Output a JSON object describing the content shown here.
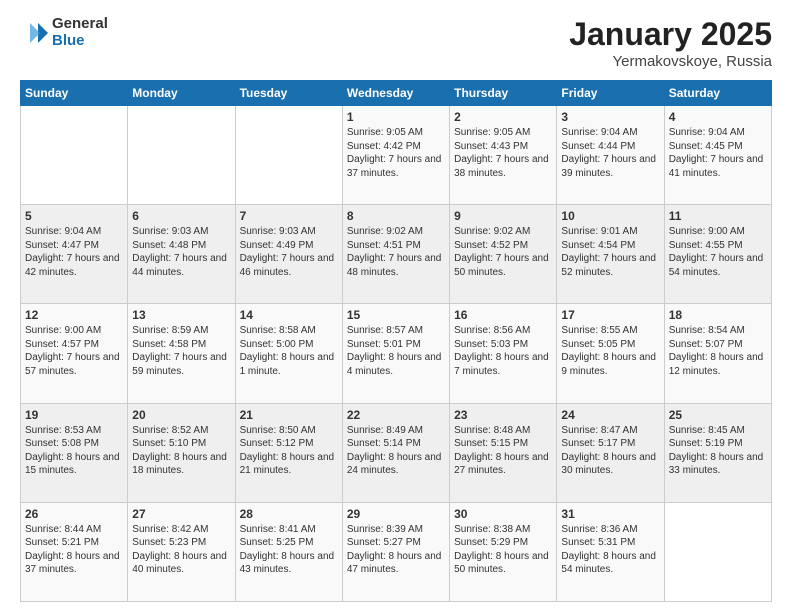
{
  "logo": {
    "general": "General",
    "blue": "Blue"
  },
  "title": "January 2025",
  "subtitle": "Yermakovskoye, Russia",
  "days_of_week": [
    "Sunday",
    "Monday",
    "Tuesday",
    "Wednesday",
    "Thursday",
    "Friday",
    "Saturday"
  ],
  "weeks": [
    [
      {
        "day": "",
        "info": ""
      },
      {
        "day": "",
        "info": ""
      },
      {
        "day": "",
        "info": ""
      },
      {
        "day": "1",
        "info": "Sunrise: 9:05 AM\nSunset: 4:42 PM\nDaylight: 7 hours and 37 minutes."
      },
      {
        "day": "2",
        "info": "Sunrise: 9:05 AM\nSunset: 4:43 PM\nDaylight: 7 hours and 38 minutes."
      },
      {
        "day": "3",
        "info": "Sunrise: 9:04 AM\nSunset: 4:44 PM\nDaylight: 7 hours and 39 minutes."
      },
      {
        "day": "4",
        "info": "Sunrise: 9:04 AM\nSunset: 4:45 PM\nDaylight: 7 hours and 41 minutes."
      }
    ],
    [
      {
        "day": "5",
        "info": "Sunrise: 9:04 AM\nSunset: 4:47 PM\nDaylight: 7 hours and 42 minutes."
      },
      {
        "day": "6",
        "info": "Sunrise: 9:03 AM\nSunset: 4:48 PM\nDaylight: 7 hours and 44 minutes."
      },
      {
        "day": "7",
        "info": "Sunrise: 9:03 AM\nSunset: 4:49 PM\nDaylight: 7 hours and 46 minutes."
      },
      {
        "day": "8",
        "info": "Sunrise: 9:02 AM\nSunset: 4:51 PM\nDaylight: 7 hours and 48 minutes."
      },
      {
        "day": "9",
        "info": "Sunrise: 9:02 AM\nSunset: 4:52 PM\nDaylight: 7 hours and 50 minutes."
      },
      {
        "day": "10",
        "info": "Sunrise: 9:01 AM\nSunset: 4:54 PM\nDaylight: 7 hours and 52 minutes."
      },
      {
        "day": "11",
        "info": "Sunrise: 9:00 AM\nSunset: 4:55 PM\nDaylight: 7 hours and 54 minutes."
      }
    ],
    [
      {
        "day": "12",
        "info": "Sunrise: 9:00 AM\nSunset: 4:57 PM\nDaylight: 7 hours and 57 minutes."
      },
      {
        "day": "13",
        "info": "Sunrise: 8:59 AM\nSunset: 4:58 PM\nDaylight: 7 hours and 59 minutes."
      },
      {
        "day": "14",
        "info": "Sunrise: 8:58 AM\nSunset: 5:00 PM\nDaylight: 8 hours and 1 minute."
      },
      {
        "day": "15",
        "info": "Sunrise: 8:57 AM\nSunset: 5:01 PM\nDaylight: 8 hours and 4 minutes."
      },
      {
        "day": "16",
        "info": "Sunrise: 8:56 AM\nSunset: 5:03 PM\nDaylight: 8 hours and 7 minutes."
      },
      {
        "day": "17",
        "info": "Sunrise: 8:55 AM\nSunset: 5:05 PM\nDaylight: 8 hours and 9 minutes."
      },
      {
        "day": "18",
        "info": "Sunrise: 8:54 AM\nSunset: 5:07 PM\nDaylight: 8 hours and 12 minutes."
      }
    ],
    [
      {
        "day": "19",
        "info": "Sunrise: 8:53 AM\nSunset: 5:08 PM\nDaylight: 8 hours and 15 minutes."
      },
      {
        "day": "20",
        "info": "Sunrise: 8:52 AM\nSunset: 5:10 PM\nDaylight: 8 hours and 18 minutes."
      },
      {
        "day": "21",
        "info": "Sunrise: 8:50 AM\nSunset: 5:12 PM\nDaylight: 8 hours and 21 minutes."
      },
      {
        "day": "22",
        "info": "Sunrise: 8:49 AM\nSunset: 5:14 PM\nDaylight: 8 hours and 24 minutes."
      },
      {
        "day": "23",
        "info": "Sunrise: 8:48 AM\nSunset: 5:15 PM\nDaylight: 8 hours and 27 minutes."
      },
      {
        "day": "24",
        "info": "Sunrise: 8:47 AM\nSunset: 5:17 PM\nDaylight: 8 hours and 30 minutes."
      },
      {
        "day": "25",
        "info": "Sunrise: 8:45 AM\nSunset: 5:19 PM\nDaylight: 8 hours and 33 minutes."
      }
    ],
    [
      {
        "day": "26",
        "info": "Sunrise: 8:44 AM\nSunset: 5:21 PM\nDaylight: 8 hours and 37 minutes."
      },
      {
        "day": "27",
        "info": "Sunrise: 8:42 AM\nSunset: 5:23 PM\nDaylight: 8 hours and 40 minutes."
      },
      {
        "day": "28",
        "info": "Sunrise: 8:41 AM\nSunset: 5:25 PM\nDaylight: 8 hours and 43 minutes."
      },
      {
        "day": "29",
        "info": "Sunrise: 8:39 AM\nSunset: 5:27 PM\nDaylight: 8 hours and 47 minutes."
      },
      {
        "day": "30",
        "info": "Sunrise: 8:38 AM\nSunset: 5:29 PM\nDaylight: 8 hours and 50 minutes."
      },
      {
        "day": "31",
        "info": "Sunrise: 8:36 AM\nSunset: 5:31 PM\nDaylight: 8 hours and 54 minutes."
      },
      {
        "day": "",
        "info": ""
      }
    ]
  ]
}
